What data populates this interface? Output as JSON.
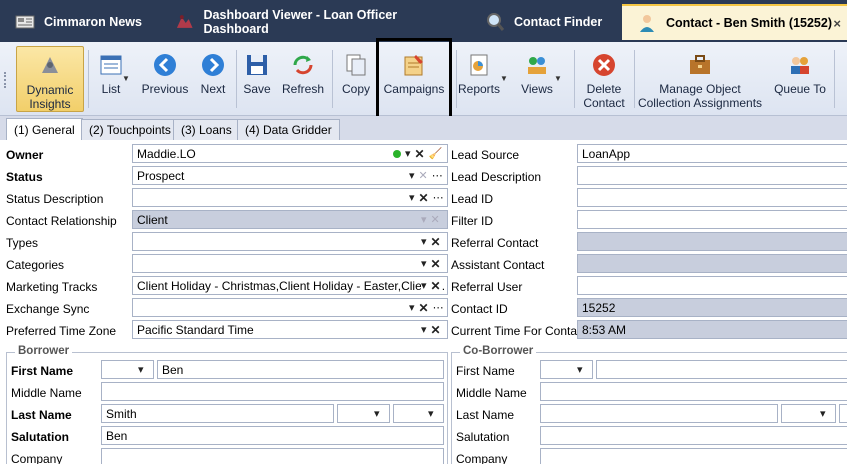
{
  "tabs": [
    {
      "label": "Cimmaron News",
      "icon": "newspaper-icon"
    },
    {
      "label": "Dashboard Viewer - Loan Officer Dashboard",
      "icon": "dashboard-icon"
    },
    {
      "label": "Contact Finder",
      "icon": "magnifier-icon"
    },
    {
      "label": "Contact - Ben Smith (15252)",
      "icon": "person-icon",
      "close": "×"
    }
  ],
  "ribbon": {
    "dynamic_insights": "Dynamic Insights",
    "list": "List",
    "previous": "Previous",
    "next": "Next",
    "save": "Save",
    "refresh": "Refresh",
    "copy": "Copy",
    "campaigns": "Campaigns",
    "reports": "Reports",
    "views": "Views",
    "delete_contact": "Delete Contact",
    "manage_object": "Manage Object Collection Assignments",
    "queue_to": "Queue To"
  },
  "subtabs": [
    "(1) General",
    "(2) Touchpoints",
    "(3) Loans",
    "(4) Data Gridder"
  ],
  "left_fields": [
    {
      "label": "Owner",
      "value": "Maddie.LO"
    },
    {
      "label": "Status",
      "value": "Prospect"
    },
    {
      "label": "Status Description",
      "value": ""
    },
    {
      "label": "Contact Relationship",
      "value": "Client"
    },
    {
      "label": "Types",
      "value": ""
    },
    {
      "label": "Categories",
      "value": ""
    },
    {
      "label": "Marketing Tracks",
      "value": "Client Holiday - Christmas,Client Holiday - Easter,Client ..."
    },
    {
      "label": "Exchange Sync",
      "value": ""
    },
    {
      "label": "Preferred Time Zone",
      "value": "Pacific Standard Time"
    }
  ],
  "right_fields": [
    {
      "label": "Lead Source",
      "value": "LoanApp"
    },
    {
      "label": "Lead Description",
      "value": ""
    },
    {
      "label": "Lead ID",
      "value": ""
    },
    {
      "label": "Filter ID",
      "value": ""
    },
    {
      "label": "Referral Contact",
      "value": ""
    },
    {
      "label": "Assistant Contact",
      "value": ""
    },
    {
      "label": "Referral User",
      "value": ""
    },
    {
      "label": "Contact ID",
      "value": "15252"
    },
    {
      "label": "Current Time For Contact",
      "value": "8:53 AM"
    }
  ],
  "borrower": {
    "title": "Borrower",
    "first_name_label": "First Name",
    "first_name": "Ben",
    "middle_name_label": "Middle Name",
    "last_name_label": "Last Name",
    "last_name": "Smith",
    "salutation_label": "Salutation",
    "salutation": "Ben",
    "company_label": "Company"
  },
  "coborrower": {
    "title": "Co-Borrower",
    "first_name_label": "First Name",
    "middle_name_label": "Middle Name",
    "last_name_label": "Last Name",
    "salutation_label": "Salutation",
    "company_label": "Company"
  },
  "colors": {
    "tabstrip": "#2b3a55",
    "active_tab": "#fbf3d6",
    "accent": "#f4c542",
    "readonly": "#c8cedd"
  }
}
